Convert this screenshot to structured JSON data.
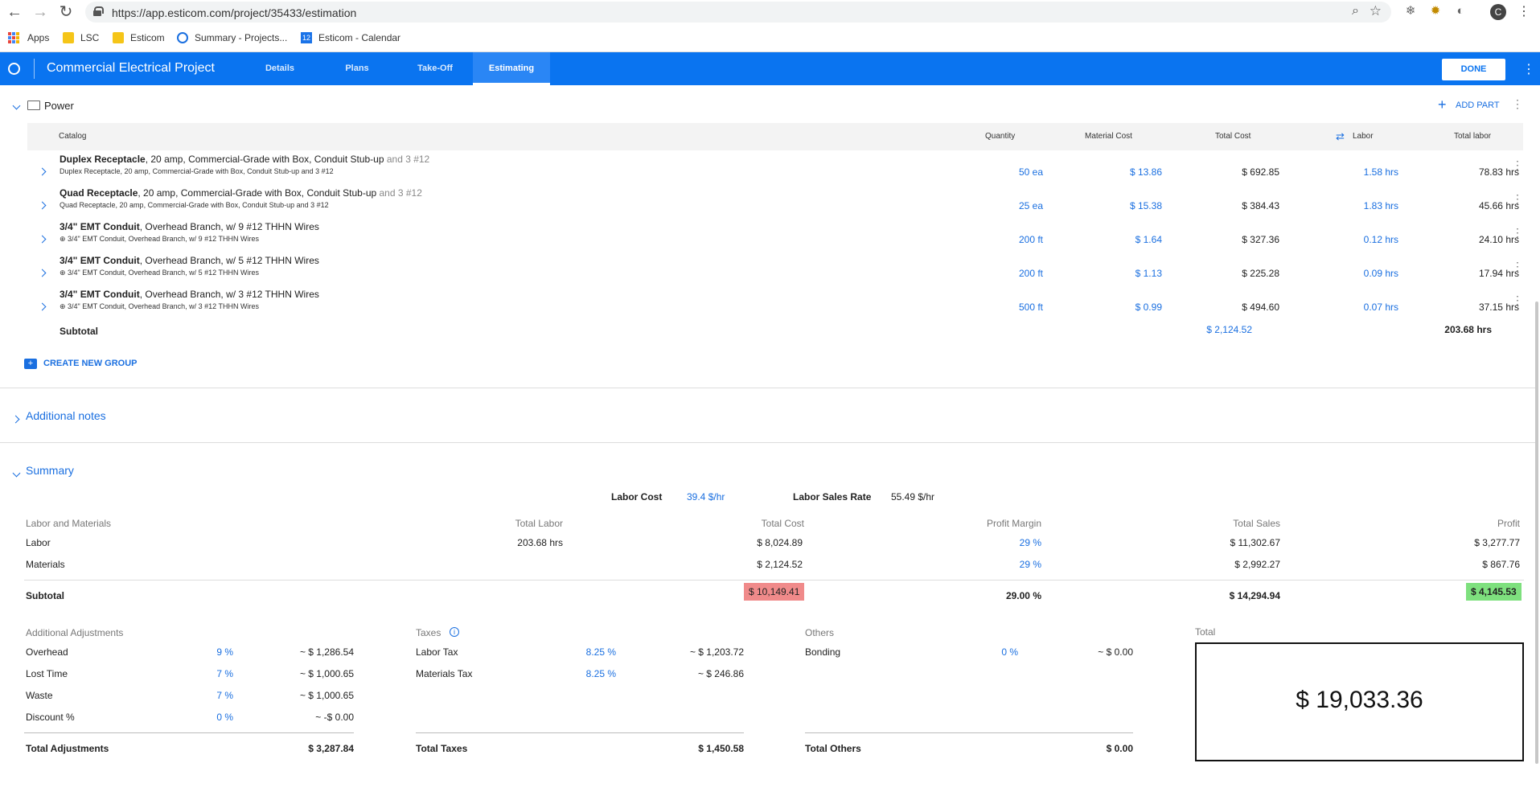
{
  "browser": {
    "url": "https://app.esticom.com/project/35433/estimation",
    "avatar_letter": "C",
    "bookmarks": [
      "Apps",
      "LSC",
      "Esticom",
      "Summary - Projects...",
      "Esticom - Calendar"
    ],
    "calendar_icon_text": "12"
  },
  "app": {
    "title": "Commercial Electrical Project",
    "tabs": [
      "Details",
      "Plans",
      "Take-Off",
      "Estimating"
    ],
    "active_tab": "Estimating",
    "done_label": "DONE"
  },
  "group": {
    "name": "Power",
    "add_part_label": "ADD PART",
    "columns": {
      "catalog": "Catalog",
      "quantity": "Quantity",
      "material_cost": "Material Cost",
      "total_cost": "Total Cost",
      "labor": "Labor",
      "total_labor": "Total labor"
    },
    "rows": [
      {
        "name_bold": "Duplex Receptacle",
        "name_rest": ", 20 amp, Commercial-Grade with Box, Conduit Stub-up",
        "name_grey": " and 3 #12",
        "sub": "Duplex Receptacle, 20 amp, Commercial-Grade with Box, Conduit Stub-up and 3 #12",
        "quantity": "50 ea",
        "material_cost": "$ 13.86",
        "total_cost": "$ 692.85",
        "labor": "1.58 hrs",
        "total_labor": "78.83 hrs"
      },
      {
        "name_bold": "Quad Receptacle",
        "name_rest": ", 20 amp, Commercial-Grade with Box, Conduit Stub-up",
        "name_grey": " and 3 #12",
        "sub": "Quad Receptacle, 20 amp, Commercial-Grade with Box, Conduit Stub-up and 3 #12",
        "quantity": "25 ea",
        "material_cost": "$ 15.38",
        "total_cost": "$ 384.43",
        "labor": "1.83 hrs",
        "total_labor": "45.66 hrs"
      },
      {
        "name_bold": "3/4\" EMT Conduit",
        "name_rest": ", Overhead Branch, w/ 9 #12 THHN Wires",
        "name_grey": "",
        "sub": "⊕ 3/4\" EMT Conduit, Overhead Branch, w/ 9 #12 THHN Wires",
        "quantity": "200 ft",
        "material_cost": "$ 1.64",
        "total_cost": "$ 327.36",
        "labor": "0.12 hrs",
        "total_labor": "24.10 hrs"
      },
      {
        "name_bold": "3/4\" EMT Conduit",
        "name_rest": ", Overhead Branch, w/ 5 #12 THHN Wires",
        "name_grey": "",
        "sub": "⊕ 3/4\" EMT Conduit, Overhead Branch, w/ 5 #12 THHN Wires",
        "quantity": "200 ft",
        "material_cost": "$ 1.13",
        "total_cost": "$ 225.28",
        "labor": "0.09 hrs",
        "total_labor": "17.94 hrs"
      },
      {
        "name_bold": "3/4\" EMT Conduit",
        "name_rest": ", Overhead Branch, w/ 3 #12 THHN Wires",
        "name_grey": "",
        "sub": "⊕ 3/4\" EMT Conduit, Overhead Branch, w/ 3 #12 THHN Wires",
        "quantity": "500 ft",
        "material_cost": "$ 0.99",
        "total_cost": "$ 494.60",
        "labor": "0.07 hrs",
        "total_labor": "37.15 hrs"
      }
    ],
    "subtotal_label": "Subtotal",
    "subtotal_cost": "$ 2,124.52",
    "subtotal_labor": "203.68 hrs"
  },
  "create_group_label": "CREATE NEW GROUP",
  "additional_notes_label": "Additional notes",
  "summary": {
    "title": "Summary",
    "labor_cost_label": "Labor Cost",
    "labor_cost_value": "39.4 $/hr",
    "labor_sales_rate_label": "Labor Sales Rate",
    "labor_sales_rate_value": "55.49 $/hr",
    "headers": {
      "labor_and_materials": "Labor and Materials",
      "total_labor": "Total Labor",
      "total_cost": "Total Cost",
      "profit_margin": "Profit Margin",
      "total_sales": "Total Sales",
      "profit": "Profit"
    },
    "labor": {
      "label": "Labor",
      "total_labor": "203.68 hrs",
      "total_cost": "$ 8,024.89",
      "margin": "29 %",
      "total_sales": "$ 11,302.67",
      "profit": "$ 3,277.77"
    },
    "materials": {
      "label": "Materials",
      "total_cost": "$ 2,124.52",
      "margin": "29 %",
      "total_sales": "$ 2,992.27",
      "profit": "$ 867.76"
    },
    "subtotal": {
      "label": "Subtotal",
      "total_cost": "$ 10,149.41",
      "margin": "29.00 %",
      "total_sales": "$ 14,294.94",
      "profit": "$ 4,145.53"
    },
    "adjustments": {
      "title": "Additional Adjustments",
      "rows": [
        {
          "label": "Overhead",
          "pct": "9 %",
          "amount": "~ $ 1,286.54"
        },
        {
          "label": "Lost Time",
          "pct": "7 %",
          "amount": "~ $ 1,000.65"
        },
        {
          "label": "Waste",
          "pct": "7 %",
          "amount": "~ $ 1,000.65"
        },
        {
          "label": "Discount %",
          "pct": "0 %",
          "amount": "~ -$ 0.00"
        }
      ],
      "total_label": "Total Adjustments",
      "total_value": "$ 3,287.84"
    },
    "taxes": {
      "title": "Taxes",
      "rows": [
        {
          "label": "Labor Tax",
          "pct": "8.25 %",
          "amount": "~ $ 1,203.72"
        },
        {
          "label": "Materials Tax",
          "pct": "8.25 %",
          "amount": "~ $ 246.86"
        }
      ],
      "total_label": "Total Taxes",
      "total_value": "$ 1,450.58"
    },
    "others": {
      "title": "Others",
      "rows": [
        {
          "label": "Bonding",
          "pct": "0 %",
          "amount": "~ $ 0.00"
        }
      ],
      "total_label": "Total Others",
      "total_value": "$ 0.00"
    },
    "total_label": "Total",
    "total_value": "$ 19,033.36"
  }
}
